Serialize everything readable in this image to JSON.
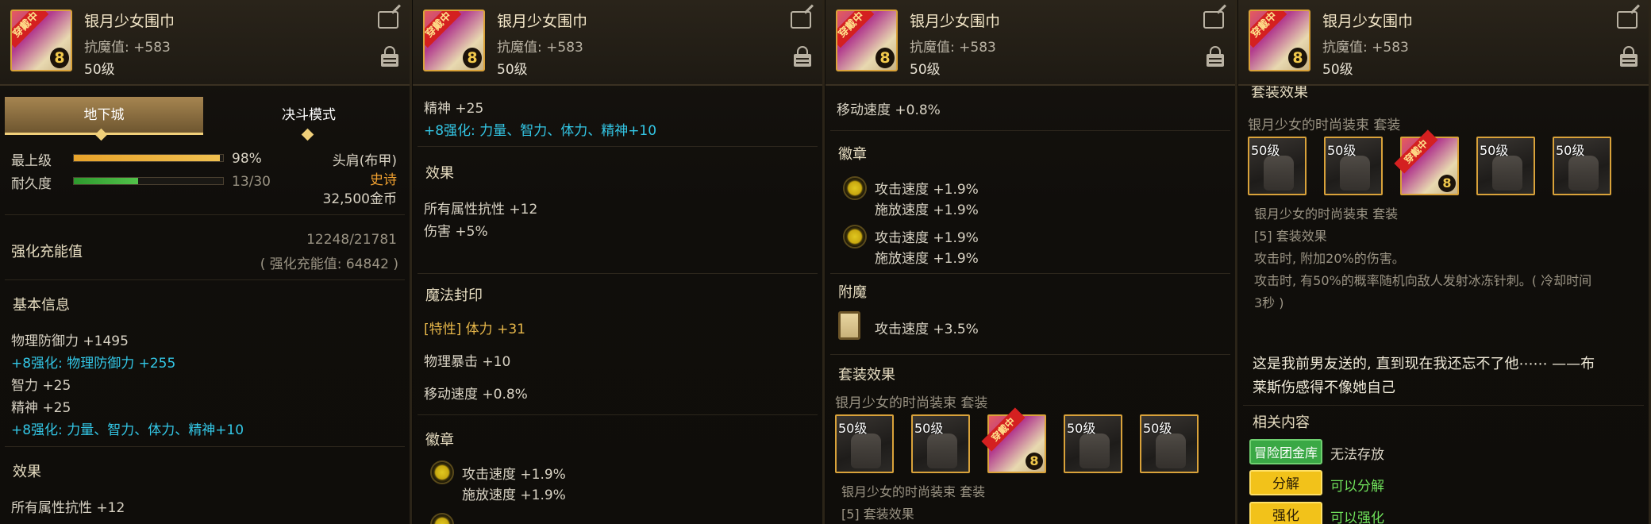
{
  "item": {
    "name": "银月少女围巾",
    "stat": "抗魔值: +583",
    "level": "50级",
    "badge": "穿戴中",
    "enhance": "8"
  },
  "panel1": {
    "tabs": [
      "地下城",
      "决斗模式"
    ],
    "max_level_label": "最上级",
    "max_level_pct": "98%",
    "max_level_value": 0.98,
    "durability_label": "耐久度",
    "durability_value": "13/30",
    "durability_fraction": 0.433,
    "slot": "头肩(布甲)",
    "rarity": "史诗",
    "price": "32,500金币",
    "charge_label": "强化充能值",
    "charge_progress": "12248/21781",
    "charge_total": "( 强化充能值: 64842 )",
    "basic_info_title": "基本信息",
    "lines": [
      "物理防御力 +1495",
      "+8强化: 物理防御力 +255",
      "智力 +25",
      "精神 +25",
      "+8强化: 力量、智力、体力、精神+10"
    ],
    "effect_title": "效果",
    "effect_line": "所有属性抗性 +12"
  },
  "panel2": {
    "spirit": "精神 +25",
    "enhance_line": "+8强化: 力量、智力、体力、精神+10",
    "effect_title": "效果",
    "effects": [
      "所有属性抗性 +12",
      "伤害 +5%"
    ],
    "seal_title": "魔法封印",
    "seal_trait": "[特性] 体力 +31",
    "seal_lines": [
      "物理暴击 +10",
      "移动速度 +0.8%"
    ],
    "emblem_title": "徽章",
    "emblem1": [
      "攻击速度 +1.9%",
      "施放速度 +1.9%"
    ]
  },
  "panel3": {
    "move_speed": "移动速度 +0.8%",
    "emblem_title": "徽章",
    "emblem1": [
      "攻击速度 +1.9%",
      "施放速度 +1.9%"
    ],
    "emblem2": [
      "攻击速度 +1.9%",
      "施放速度 +1.9%"
    ],
    "enchant_title": "附魔",
    "enchant_line": "攻击速度 +3.5%",
    "set_title": "套装效果",
    "set_name": "银月少女的时尚装束 套装",
    "slots": [
      "50级",
      "50级",
      "",
      "50级",
      "50级"
    ],
    "set_name2": "银月少女的时尚装束 套装",
    "set_effect_cut": "[5] 套装效果"
  },
  "panel4": {
    "set_title_cut": "套装效果",
    "set_name": "银月少女的时尚装束 套装",
    "slots": [
      "50级",
      "50级",
      "",
      "50级",
      "50级"
    ],
    "set_name2": "银月少女的时尚装束 套装",
    "set_effect": "[5] 套装效果",
    "effect1": "攻击时, 附加20%的伤害。",
    "effect2a": "攻击时, 有50%的概率随机向敌人发射冰冻针刺。( 冷却时间",
    "effect2b": "3秒 )",
    "flavor_a": "这是我前男友送的, 直到现在我还忘不了他⋯⋯ ——布",
    "flavor_b": "莱斯伤感得不像她自己",
    "related_title": "相关内容",
    "btn_bank": "冒险团金库",
    "bank_status": "无法存放",
    "btn_disassemble": "分解",
    "disassemble_status": "可以分解",
    "btn_cut": "强化",
    "cut_status": "可以强化"
  },
  "colors": {
    "cyan": "#33c7e6",
    "gold": "#e8b84a",
    "epic": "#f0a030",
    "green_text": "#6fe05a",
    "border_gold": "#d9a23a"
  }
}
